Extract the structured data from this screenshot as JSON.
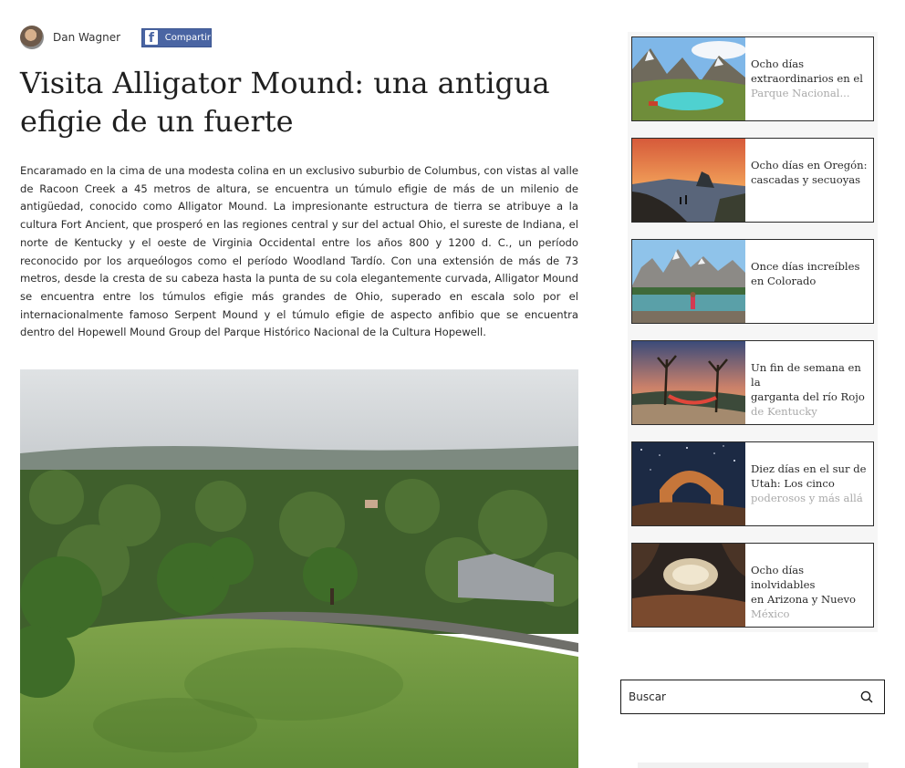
{
  "author": {
    "name": "Dan Wagner",
    "share_label": "Compartir",
    "share_icon": "facebook-icon"
  },
  "post": {
    "title": "Visita Alligator Mound: una antigua efigie de un fuerte",
    "body": "Encaramado en la cima de una modesta colina en un exclusivo suburbio de Columbus, con vistas al valle de Racoon Creek a 45 metros de altura, se encuentra un túmulo efigie de más de un milenio de antigüedad, conocido como Alligator Mound. La impresionante estructura de tierra se atribuye a la cultura Fort Ancient, que prosperó en las regiones central y sur del actual Ohio, el sureste de Indiana, el norte de Kentucky y el oeste de Virginia Occidental entre los años 800 y 1200 d. C., un período reconocido por los arqueólogos como el período Woodland Tardío. Con una extensión de más de 73 metros, desde la cresta de su cabeza hasta la punta de su cola elegantemente curvada, Alligator Mound se encuentra entre los túmulos efigie más grandes de Ohio, superado en escala solo por el internacionalmente famoso Serpent Mound y el túmulo efigie de aspecto anfibio que se encuentra dentro del Hopewell Mound Group del Parque Histórico Nacional de la Cultura Hopewell."
  },
  "sidebar": {
    "cards": [
      {
        "line1": "Ocho días",
        "line2": "extraordinarios en el",
        "line3": "Parque Nacional..."
      },
      {
        "line1": "Ocho días en Oregón:",
        "line2": "cascadas y secuoyas",
        "line3": ""
      },
      {
        "line1": "Once días increíbles",
        "line2": "en Colorado",
        "line3": ""
      },
      {
        "line1": "Un fin de semana en la",
        "line2": "garganta del río Rojo",
        "line3": "de Kentucky"
      },
      {
        "line1": "Diez días en el sur de",
        "line2": "Utah: Los cinco",
        "line3": "poderosos y más allá"
      },
      {
        "line1": "Ocho días inolvidables",
        "line2": "en Arizona y Nuevo",
        "line3": "México"
      }
    ]
  },
  "search": {
    "placeholder": "Buscar",
    "icon": "search-icon"
  }
}
